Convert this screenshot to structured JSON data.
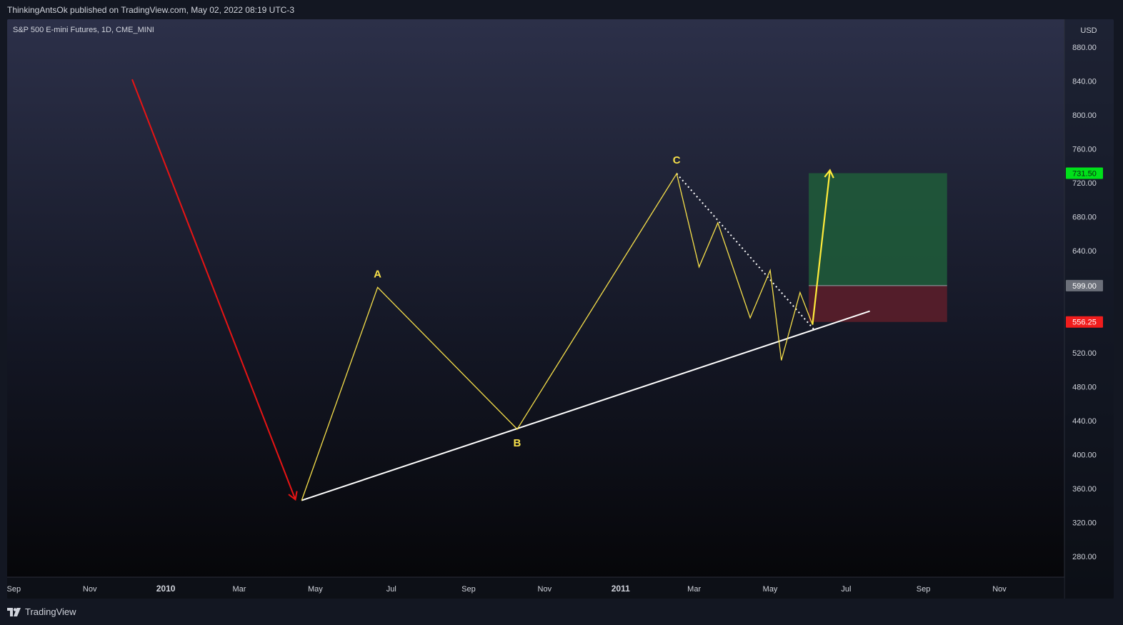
{
  "header": {
    "published_text": "ThinkingAntsOk published on TradingView.com, May 02, 2022 08:19 UTC-3"
  },
  "footer": {
    "brand_text": "TradingView",
    "brand_icon": "tradingview-logo-icon"
  },
  "colors": {
    "pattern_line": "#f7e04a",
    "projection_arrow": "#ffeb3b",
    "trend_line": "#ffffff",
    "down_arrow": "#e81414",
    "target_zone": "#1f5a3a",
    "stop_zone": "#5a1e2a",
    "target_badge": "#00e01a",
    "entry_badge": "#6b6f79",
    "stop_badge": "#f01d1d",
    "axis_text": "#d1d4dc"
  },
  "chart_data": {
    "type": "line",
    "title": "S&P 500 E-mini Futures, 1D, CME_MINI",
    "currency": "USD",
    "xlabel": "",
    "ylabel": "",
    "ylim": [
      248,
      888
    ],
    "x_ticks": [
      "Sep",
      "Nov",
      "2010",
      "Mar",
      "May",
      "Jul",
      "Sep",
      "Nov",
      "2011",
      "Mar",
      "May",
      "Jul",
      "Sep",
      "Nov"
    ],
    "y_ticks": [
      "880.00",
      "840.00",
      "800.00",
      "760.00",
      "720.00",
      "680.00",
      "640.00",
      "600.00",
      "560.00",
      "520.00",
      "480.00",
      "440.00",
      "400.00",
      "360.00",
      "320.00",
      "280.00"
    ],
    "pattern_wave": {
      "x": [
        "2010-04-20",
        "2010-06-20",
        "2010-10-10",
        "2011-02-15",
        "2011-03-05",
        "2011-03-20",
        "2011-04-15",
        "2011-05-01",
        "2011-05-10",
        "2011-05-25",
        "2011-06-04"
      ],
      "y": [
        346,
        597,
        430,
        731,
        621,
        673,
        561,
        617,
        511,
        591,
        553
      ]
    },
    "wave_labels": [
      {
        "text": "A",
        "x": "2010-06-20",
        "y": 597
      },
      {
        "text": "B",
        "x": "2010-10-10",
        "y": 430
      },
      {
        "text": "C",
        "x": "2011-02-15",
        "y": 731
      }
    ],
    "down_arrow": {
      "from": {
        "x": "2009-12-05",
        "y": 842
      },
      "to": {
        "x": "2010-04-15",
        "y": 347
      }
    },
    "trend_line": {
      "from": {
        "x": "2010-04-20",
        "y": 346
      },
      "to": {
        "x": "2011-07-20",
        "y": 569
      }
    },
    "dotted_line": {
      "from": {
        "x": "2011-02-15",
        "y": 731
      },
      "to": {
        "x": "2011-06-06",
        "y": 546
      }
    },
    "projection_arrow": {
      "from": {
        "x": "2011-06-04",
        "y": 553
      },
      "to": {
        "x": "2011-07-00",
        "y": 735
      }
    },
    "position": {
      "start": "2011-06-01",
      "end": "2011-09-20",
      "target": 731.5,
      "entry": 599.0,
      "stop": 556.25,
      "target_label": "731.50",
      "entry_label": "599.00",
      "stop_label": "556.25"
    }
  }
}
